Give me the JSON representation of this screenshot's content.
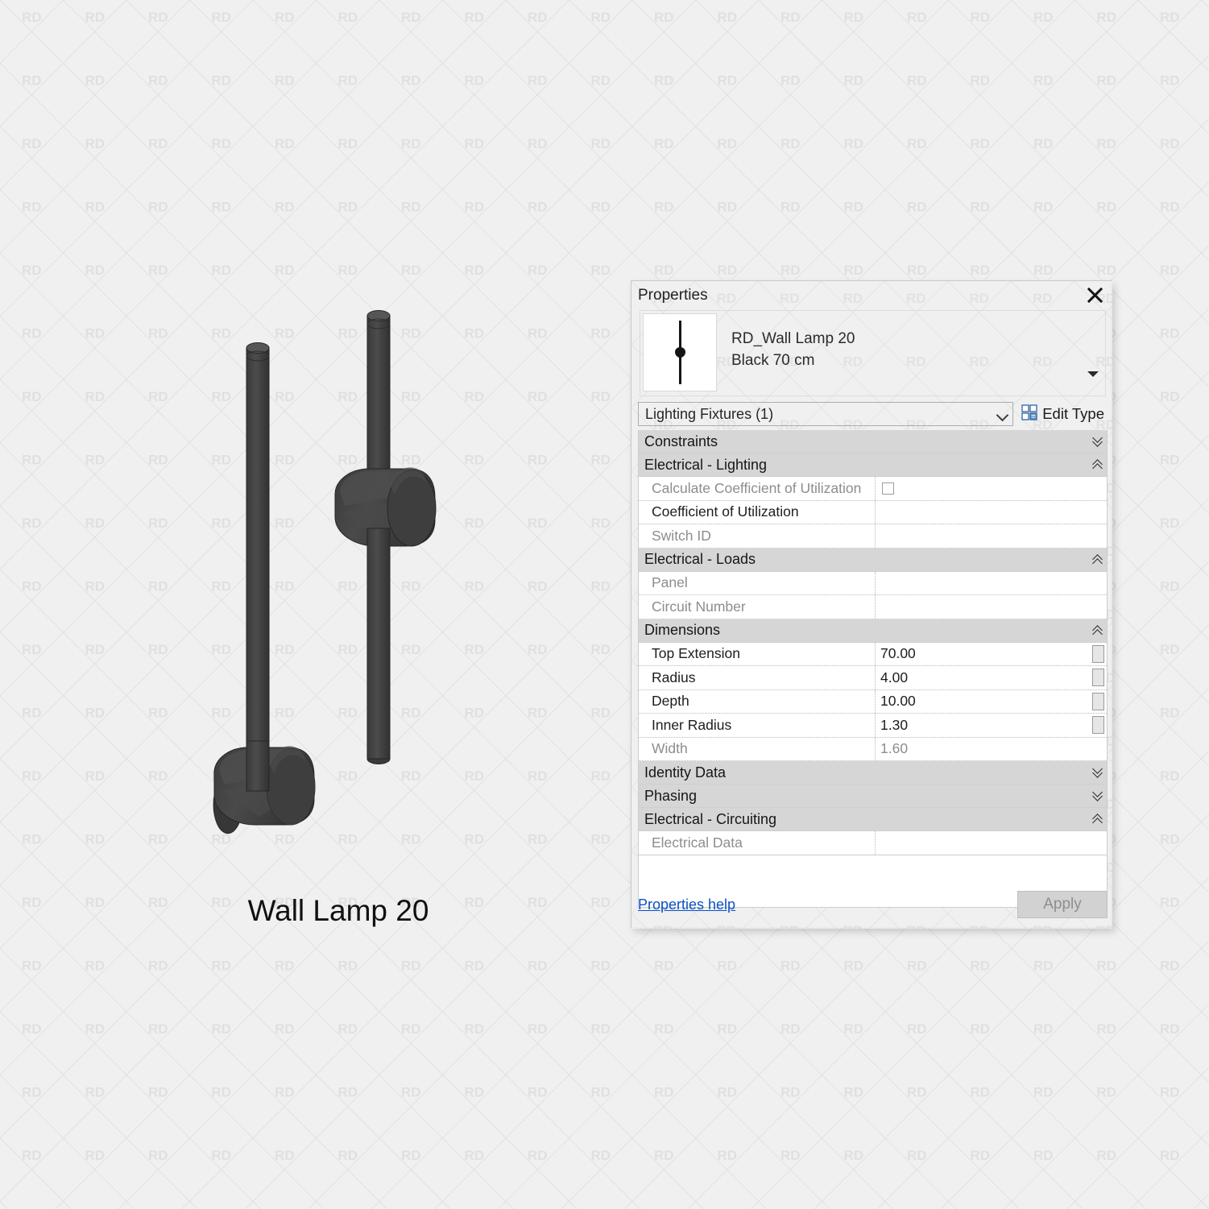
{
  "background": {
    "watermark_text": "RD",
    "bg_color": "#f0f0f0",
    "watermark_color": "#e0e0e0"
  },
  "illustration": {
    "caption": "Wall Lamp 20",
    "body_color": "#3d3d3d",
    "shade_dark": "#333333",
    "shade_light": "#4a4a4a"
  },
  "panel": {
    "title": "Properties",
    "close_icon": "close-icon",
    "type_name_line1": "RD_Wall Lamp 20",
    "type_name_line2": "Black 70 cm",
    "thumbnail_icon": "wall-lamp-preview-icon",
    "type_dropdown_icon": "caret-down-icon",
    "category": "Lighting Fixtures (1)",
    "category_chevron_icon": "chevron-down-icon",
    "edit_type_label": "Edit Type",
    "edit_type_icon": "edit-type-grid-icon",
    "help_label": "Properties help",
    "apply_label": "Apply",
    "apply_enabled": false,
    "link_color": "#0b52c6"
  },
  "groups": [
    {
      "name": "Constraints",
      "toggle_icon": "chevron-double-down-icon",
      "collapsed": true,
      "rows": []
    },
    {
      "name": "Electrical - Lighting",
      "toggle_icon": "chevron-double-up-icon",
      "collapsed": false,
      "rows": [
        {
          "label": "Calculate Coefficient of Utilization",
          "value": "",
          "disabled": true,
          "control": "checkbox",
          "checked": false,
          "minibtn": false
        },
        {
          "label": "Coefficient of Utilization",
          "value": "",
          "disabled": false,
          "control": "text",
          "minibtn": false
        },
        {
          "label": "Switch ID",
          "value": "",
          "disabled": true,
          "control": "text",
          "minibtn": false
        }
      ]
    },
    {
      "name": "Electrical - Loads",
      "toggle_icon": "chevron-double-up-icon",
      "collapsed": false,
      "rows": [
        {
          "label": "Panel",
          "value": "",
          "disabled": true,
          "control": "text",
          "minibtn": false
        },
        {
          "label": "Circuit Number",
          "value": "",
          "disabled": true,
          "control": "text",
          "minibtn": false
        }
      ]
    },
    {
      "name": "Dimensions",
      "toggle_icon": "chevron-double-up-icon",
      "collapsed": false,
      "rows": [
        {
          "label": "Top Extension",
          "value": "70.00",
          "disabled": false,
          "control": "text",
          "minibtn": true
        },
        {
          "label": "Radius",
          "value": "4.00",
          "disabled": false,
          "control": "text",
          "minibtn": true
        },
        {
          "label": "Depth",
          "value": "10.00",
          "disabled": false,
          "control": "text",
          "minibtn": true
        },
        {
          "label": "Inner Radius",
          "value": "1.30",
          "disabled": false,
          "control": "text",
          "minibtn": true
        },
        {
          "label": "Width",
          "value": "1.60",
          "disabled": true,
          "control": "text",
          "minibtn": false
        }
      ]
    },
    {
      "name": "Identity Data",
      "toggle_icon": "chevron-double-down-icon",
      "collapsed": true,
      "rows": []
    },
    {
      "name": "Phasing",
      "toggle_icon": "chevron-double-down-icon",
      "collapsed": true,
      "rows": []
    },
    {
      "name": "Electrical - Circuiting",
      "toggle_icon": "chevron-double-up-icon",
      "collapsed": false,
      "rows": [
        {
          "label": "Electrical Data",
          "value": "",
          "disabled": true,
          "control": "text",
          "minibtn": false
        }
      ]
    }
  ]
}
